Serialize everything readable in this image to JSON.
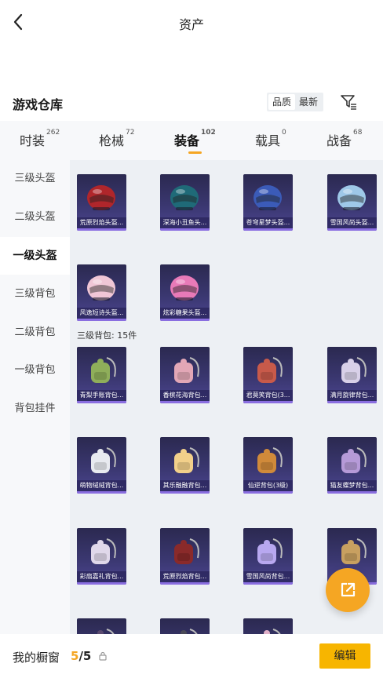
{
  "header": {
    "title": "资产",
    "back_icon": "chevron-left-icon"
  },
  "warehouse": {
    "title": "游戏仓库",
    "sort_options": [
      "品质",
      "最新"
    ],
    "filter_icon": "filter-icon"
  },
  "tabs": [
    {
      "label": "时装",
      "count": "262"
    },
    {
      "label": "枪械",
      "count": "72"
    },
    {
      "label": "装备",
      "count": "102",
      "active": true
    },
    {
      "label": "载具",
      "count": "0"
    },
    {
      "label": "战备",
      "count": "68"
    }
  ],
  "sidebar": [
    {
      "label": "三级头盔"
    },
    {
      "label": "二级头盔"
    },
    {
      "label": "一级头盔",
      "active": true
    },
    {
      "label": "三级背包"
    },
    {
      "label": "二级背包"
    },
    {
      "label": "一级背包"
    },
    {
      "label": "背包挂件"
    }
  ],
  "helmets": [
    {
      "name": "荒原烈焰头盔...",
      "icon": "helmet-icon",
      "color": "#b0262b"
    },
    {
      "name": "深海小丑鱼头...",
      "icon": "helmet-icon",
      "color": "#1f6a78"
    },
    {
      "name": "苍穹星梦头盔...",
      "icon": "helmet-icon",
      "color": "#3b5bb8"
    },
    {
      "name": "雪国风尚头盔...",
      "icon": "helmet-icon",
      "color": "#9ec8e8"
    },
    {
      "name": "风逸短诗头盔...",
      "icon": "helmet-icon",
      "color": "#f0c6d6"
    },
    {
      "name": "炫彩糖果头盔...",
      "icon": "helmet-icon",
      "color": "#e87ab8"
    }
  ],
  "backpack_section_label": "三级背包: 15件",
  "backpacks": [
    {
      "name": "青梨手账背包...",
      "icon": "backpack-icon",
      "color": "#8fae5a"
    },
    {
      "name": "香槟花海背包...",
      "icon": "backpack-icon",
      "color": "#e2a7b6"
    },
    {
      "name": "君莫笑背包(3...",
      "icon": "backpack-icon",
      "color": "#c85a4a"
    },
    {
      "name": "满月旋律背包...",
      "icon": "backpack-icon",
      "color": "#d8d0e8"
    },
    {
      "name": "萌物绒绒背包...",
      "icon": "backpack-icon",
      "color": "#e8eaf0"
    },
    {
      "name": "其乐融融背包...",
      "icon": "backpack-icon",
      "color": "#f2d08a"
    },
    {
      "name": "仙逆背包(3级)",
      "icon": "backpack-icon",
      "color": "#d08a3a"
    },
    {
      "name": "猫友蝶梦背包...",
      "icon": "backpack-icon",
      "color": "#b69ad8"
    },
    {
      "name": "彩扇嘉礼背包...",
      "icon": "backpack-icon",
      "color": "#e0d8ea"
    },
    {
      "name": "荒原烈焰背包...",
      "icon": "backpack-icon",
      "color": "#8a2a2a"
    },
    {
      "name": "雪国风尚背包...",
      "icon": "backpack-icon",
      "color": "#b8a8f0"
    },
    {
      "name": "",
      "icon": "backpack-icon",
      "color": "#c8a060"
    },
    {
      "name": "",
      "icon": "backpack-icon",
      "color": "#5a4a70"
    },
    {
      "name": "",
      "icon": "backpack-icon",
      "color": "#4a4a58"
    },
    {
      "name": "",
      "icon": "backpack-icon",
      "color": "#e0b0c8"
    }
  ],
  "bottom": {
    "title": "我的橱窗",
    "count_current": "5",
    "count_total": "/5",
    "lock_icon": "lock-icon",
    "edit_label": "编辑"
  },
  "fab_icon": "share-icon",
  "colors": {
    "accent": "#f5a623",
    "card_bg": "#3a3770",
    "button": "#f7b500"
  }
}
